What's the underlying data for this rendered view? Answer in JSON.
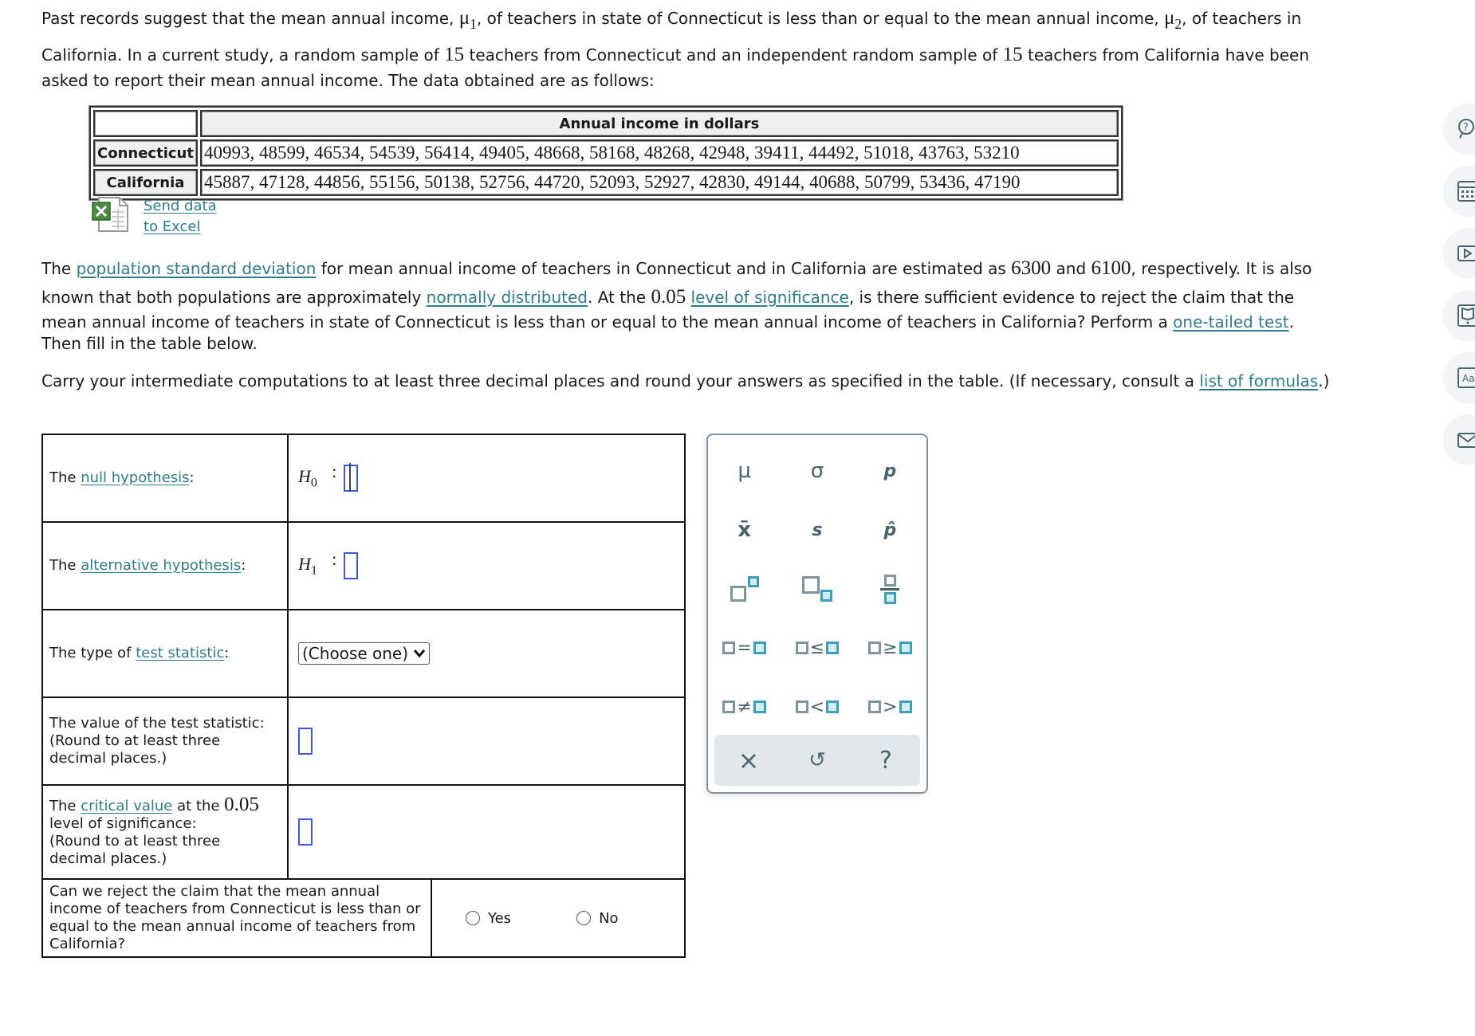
{
  "intro": {
    "line1_a": "Past records suggest that the mean annual income, ",
    "mu1": "μ",
    "mu1_sub": "1",
    "line1_b": ", of teachers in state of Connecticut is less than or equal to the mean annual income, ",
    "mu2": "μ",
    "mu2_sub": "2",
    "line1_c": ", of teachers in",
    "line2_a": "California. In a current study, a random sample of ",
    "n1": "15",
    "line2_b": " teachers from Connecticut and an independent random sample of ",
    "n2": "15",
    "line2_c": " teachers from California have been",
    "line3": "asked to report their mean annual income. The data obtained are as follows:"
  },
  "data_table": {
    "header": "Annual income in dollars",
    "rows": [
      {
        "label": "Connecticut",
        "values": "40993, 48599, 46534, 54539, 56414, 49405, 48668, 58168, 48268, 42948, 39411, 44492, 51018, 43763, 53210"
      },
      {
        "label": "California",
        "values": "45887, 47128, 44856, 55156, 50138, 52756, 44720, 52093, 52927, 42830, 49144, 40688, 50799, 53436, 47190"
      }
    ]
  },
  "excel": {
    "line1": "Send data",
    "line2": "to Excel"
  },
  "problem": {
    "p1_a": "The ",
    "p1_link": "population standard deviation",
    "p1_b": " for mean annual income of teachers in Connecticut and in California are estimated as ",
    "sd1": "6300",
    "p1_c": " and ",
    "sd2": "6100",
    "p1_d": ", respectively. It is also",
    "p2_a": "known that both populations are approximately ",
    "p2_link1": "normally distributed",
    "p2_b": ". At the ",
    "alpha": "0.05",
    "p2_c": " ",
    "p2_link2": "level of significance",
    "p2_d": ", is there sufficient evidence to reject the claim that the",
    "p3_a": "mean annual income of teachers in state of Connecticut is less than or equal to the mean annual income of teachers in California? Perform a ",
    "p3_link": "one-tailed test",
    "p3_b": ".",
    "p4": "Then fill in the table below.",
    "carry_a": "Carry your intermediate computations to at least three decimal places and round your answers as specified in the table. (If necessary, consult a ",
    "carry_link": "list of formulas",
    "carry_b": ".)"
  },
  "answer_table": {
    "null": {
      "pre": "The ",
      "link": "null hypothesis",
      "post": ":",
      "symbol": "H",
      "sub": "0",
      "colon": ":"
    },
    "alt": {
      "pre": "The ",
      "link": "alternative hypothesis",
      "post": ":",
      "symbol": "H",
      "sub": "1",
      "colon": ":"
    },
    "type": {
      "pre": "The type of ",
      "link": "test statistic",
      "post": ":",
      "select_value": "(Choose one)"
    },
    "value": {
      "line1": "The value of the test statistic:",
      "line2": "(Round to at least three",
      "line3": "decimal places.)"
    },
    "critical": {
      "pre": "The ",
      "link": "critical value",
      "mid": " at the ",
      "alpha": "0.05",
      "line2": "level of significance:",
      "line3": "(Round to at least three",
      "line4": "decimal places.)"
    },
    "reject": {
      "question": "Can we reject the claim that the mean annual income of teachers from Connecticut is less than or equal to the mean annual income of teachers from California?",
      "yes": "Yes",
      "no": "No"
    }
  },
  "palette": {
    "symbols": [
      "μ",
      "σ",
      "p",
      "x̄",
      "s",
      "p̂"
    ],
    "relations": [
      "=",
      "≤",
      "≥",
      "≠",
      "<",
      ">"
    ],
    "actions": {
      "clear": "×",
      "undo": "↺",
      "help": "?"
    }
  },
  "rail": [
    "help-chat-icon",
    "calculator-icon",
    "video-icon",
    "ebook-icon",
    "glossary-icon",
    "message-icon"
  ],
  "colors": {
    "link": "#2e7d8c",
    "input_border": "#3d5bd9",
    "palette_border": "#7f959e",
    "palette_accent": "#3f9fb8"
  }
}
